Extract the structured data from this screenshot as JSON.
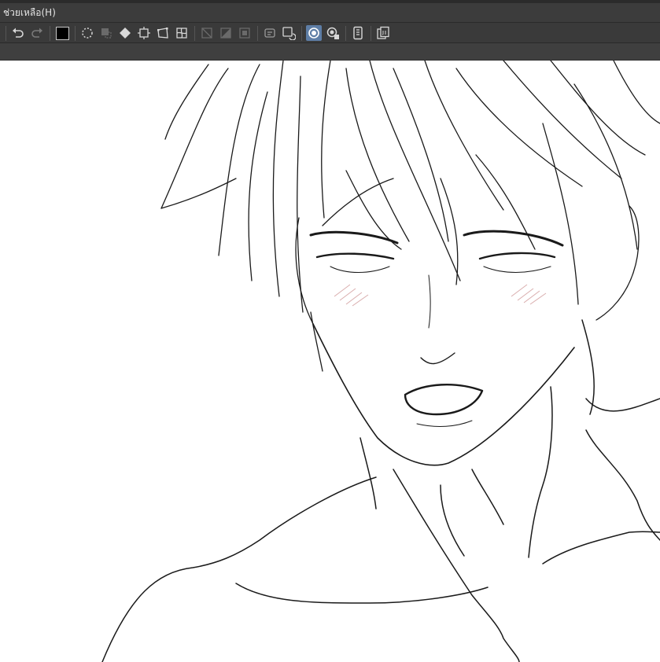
{
  "menubar": {
    "help_label": "ช่วยเหลือ(H)"
  },
  "toolbar": {
    "buttons": [
      {
        "name": "undo-icon"
      },
      {
        "name": "redo-icon"
      },
      {
        "name": "main-color-swatch",
        "color": "#000000"
      },
      {
        "name": "select-all-icon"
      },
      {
        "name": "deselect-icon"
      },
      {
        "name": "fill-icon"
      },
      {
        "name": "scale-rotate-icon"
      },
      {
        "name": "free-transform-icon"
      },
      {
        "name": "mesh-transform-icon"
      },
      {
        "name": "clear-selection-icon"
      },
      {
        "name": "fill-selection-icon"
      },
      {
        "name": "crop-icon"
      },
      {
        "name": "new-layer-icon"
      },
      {
        "name": "rotate-canvas-icon"
      },
      {
        "name": "snap-to-ruler-icon",
        "active": true
      },
      {
        "name": "snap-to-special-ruler-icon"
      },
      {
        "name": "smartphone-connect-icon"
      },
      {
        "name": "export-jpeg-icon"
      }
    ]
  },
  "colors": {
    "menubar_bg": "#3c3c3c",
    "toolbar_bg": "#3a3a3a",
    "active_button": "#5e7ea6",
    "canvas_bg": "#ffffff",
    "lineart": "#1a1a1a",
    "blush": "#c98a8a"
  }
}
